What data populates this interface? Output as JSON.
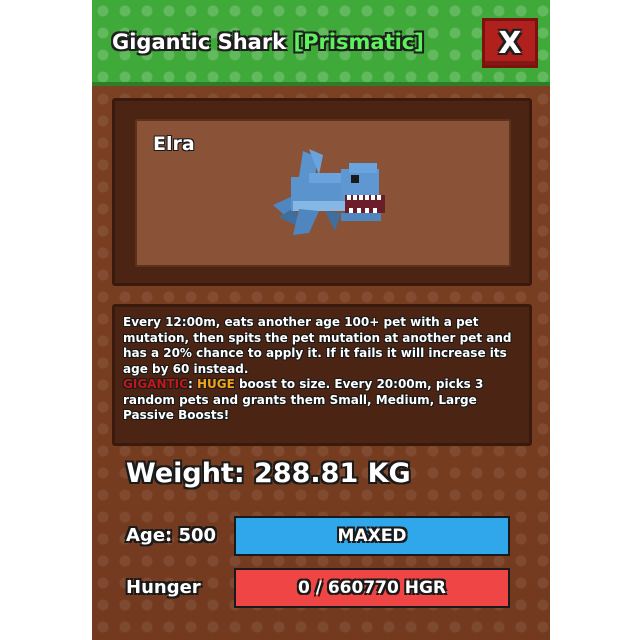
{
  "window": {
    "title": "Gigantic Shark",
    "rarity_tag": "[Prismatic]",
    "close_label": "X"
  },
  "pet": {
    "owner_name": "Elra",
    "image_icon": "blue-shark-pet-icon"
  },
  "description": {
    "line1": "Every 12:00m, eats another age 100+ pet with a pet mutation, then spits the pet mutation at another pet and has a 20% chance to apply it. If it fails it will increase its age by 60 instead.",
    "mutation_name": "GIGANTIC",
    "mutation_sep": ": ",
    "boost_word": "HUGE",
    "line2": " boost to size. Every 20:00m, picks 3 random pets and grants them Small, Medium, Large Passive Boosts!"
  },
  "stats": {
    "weight_label": "Weight: 288.81 KG",
    "age_label": "Age: 500",
    "age_bar_text": "MAXED",
    "age_fill": 1.0,
    "hunger_label": "Hunger",
    "hunger_bar_text": "0 / 660770 HGR",
    "hunger_fill": 1.0
  },
  "colors": {
    "header_green": "#3fa93a",
    "rarity_green": "#5bf25b",
    "close_red": "#b0201c",
    "age_bar": "#2fa7ea",
    "hunger_bar": "#ef4545",
    "mutation_red": "#c01818",
    "boost_orange": "#f4a21a"
  }
}
